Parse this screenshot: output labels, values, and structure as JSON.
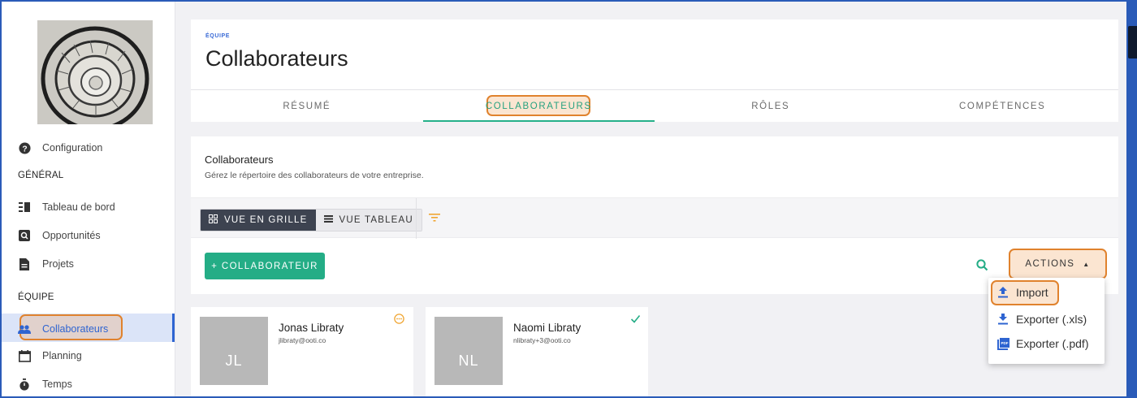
{
  "sidebar": {
    "items": [
      {
        "label": "Configuration",
        "icon": "help-circle-icon"
      },
      {
        "label": "Tableau de bord",
        "icon": "dashboard-icon"
      },
      {
        "label": "Opportunités",
        "icon": "search-box-icon"
      },
      {
        "label": "Projets",
        "icon": "document-icon"
      },
      {
        "label": "Collaborateurs",
        "icon": "people-icon"
      },
      {
        "label": "Planning",
        "icon": "calendar-icon"
      },
      {
        "label": "Temps",
        "icon": "stopwatch-icon"
      }
    ],
    "sections": {
      "general": "GÉNÉRAL",
      "equipe": "ÉQUIPE"
    },
    "active_color": "#2e64d1"
  },
  "header": {
    "eyebrow": "ÉQUIPE",
    "title": "Collaborateurs",
    "tabs": [
      {
        "label": "RÉSUMÉ"
      },
      {
        "label": "COLLABORATEURS",
        "active": true
      },
      {
        "label": "RÔLES"
      },
      {
        "label": "COMPÉTENCES"
      }
    ]
  },
  "main": {
    "section_title": "Collaborateurs",
    "section_subtitle": "Gérez le répertoire des collaborateurs de votre entreprise.",
    "view_toggle": {
      "grid": "VUE EN GRILLE",
      "table": "VUE TABLEAU",
      "selected": "grid"
    },
    "add_button": "+ COLLABORATEUR",
    "actions_button": "ACTIONS",
    "accent_color": "#24ad86"
  },
  "actions_menu": {
    "items": [
      {
        "label": "Import",
        "icon": "upload-icon"
      },
      {
        "label": "Exporter (.xls)",
        "icon": "download-icon"
      },
      {
        "label": "Exporter (.pdf)",
        "icon": "pdf-icon"
      }
    ]
  },
  "employees": [
    {
      "initials": "JL",
      "name": "Jonas Libraty",
      "email": "jlibraty@ooti.co",
      "status": "pending-icon"
    },
    {
      "initials": "NL",
      "name": "Naomi Libraty",
      "email": "nlibraty+3@ooti.co",
      "status": "check-icon"
    }
  ],
  "highlight_color": "#e0822d"
}
